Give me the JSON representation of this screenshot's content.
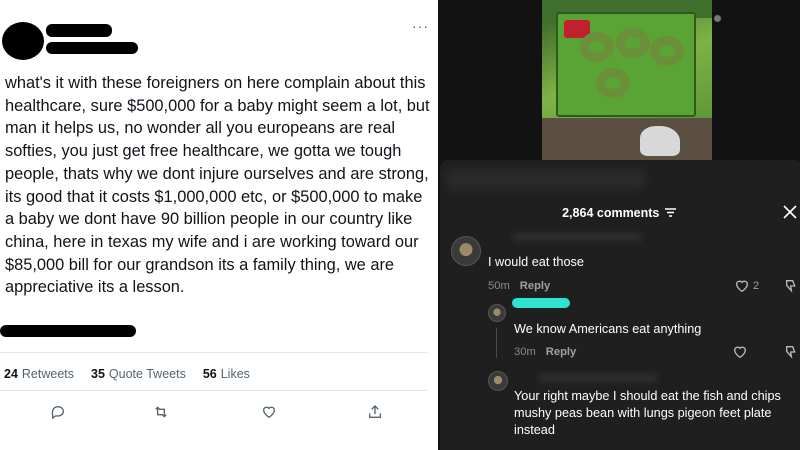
{
  "tweet": {
    "menu_glyph": "···",
    "text": "what's it with these foreigners on here complain about this healthcare, sure $500,000 for a baby might seem a lot, but man it helps us, no wonder all you europeans are real softies, you just get free healthcare, we gotta we tough people, thats why we dont injure ourselves and are strong, its good that it costs $1,000,000 etc, or $500,000 to make a baby we dont have 90 billion people in our country like china, here in texas my wife and i are working toward our $85,000 bill for our grandson its a family thing, we are appreciative its a lesson.",
    "stats": [
      {
        "count": "24",
        "label": "Retweets"
      },
      {
        "count": "35",
        "label": "Quote Tweets"
      },
      {
        "count": "56",
        "label": "Likes"
      }
    ],
    "actions": [
      "reply-icon",
      "retweet-icon",
      "like-icon",
      "share-icon"
    ]
  },
  "comments_panel": {
    "count_label": "2,864 comments",
    "comments": [
      {
        "text": "I would eat those",
        "time": "50m",
        "reply": "Reply",
        "likes": "2"
      },
      {
        "text": "We know Americans eat anything",
        "time": "30m",
        "reply": "Reply",
        "likes": ""
      },
      {
        "text": "Your right maybe I should eat the fish and chips mushy peas bean with lungs pigeon feet plate instead",
        "time": "",
        "reply": "",
        "likes": ""
      }
    ]
  },
  "colors": {
    "tweet_text": "#0f1419",
    "muted": "#536471",
    "dark_bg": "#121212",
    "sheet_bg": "#1f1f1f",
    "redaction_cyan": "#2fe3d0"
  }
}
